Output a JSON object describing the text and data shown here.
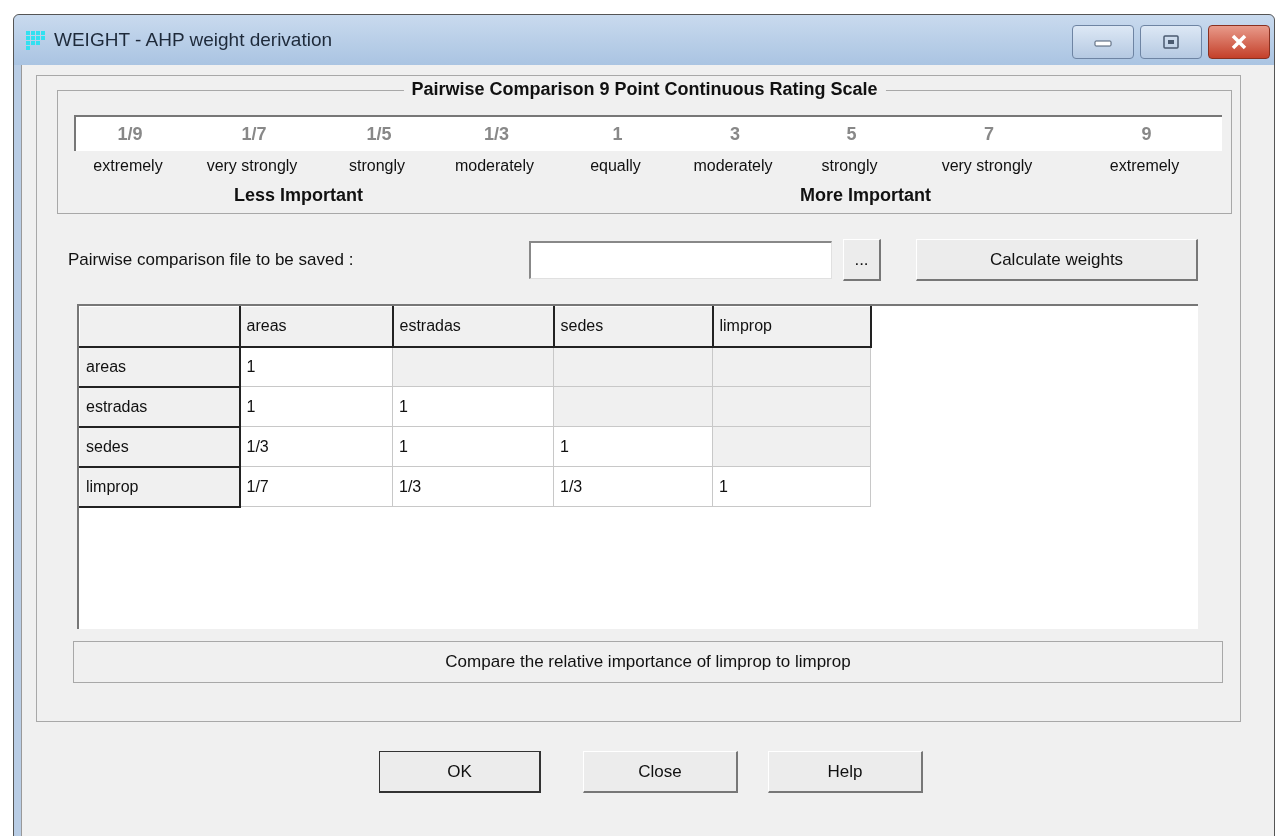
{
  "window": {
    "title": "WEIGHT - AHP weight derivation"
  },
  "scale": {
    "title": "Pairwise Comparison 9 Point Continuous Rating Scale",
    "points": [
      {
        "value": "1/9",
        "label": "extremely"
      },
      {
        "value": "1/7",
        "label": "very strongly"
      },
      {
        "value": "1/5",
        "label": "strongly"
      },
      {
        "value": "1/3",
        "label": "moderately"
      },
      {
        "value": "1",
        "label": "equally"
      },
      {
        "value": "3",
        "label": "moderately"
      },
      {
        "value": "5",
        "label": "strongly"
      },
      {
        "value": "7",
        "label": "very strongly"
      },
      {
        "value": "9",
        "label": "extremely"
      }
    ],
    "sides": [
      "Less Important",
      "More Important"
    ]
  },
  "file_field": {
    "label": "Pairwise comparison file to be saved :",
    "browse_button": "...",
    "calculate_button": "Calculate weights"
  },
  "table": {
    "columns": [
      "areas",
      "estradas",
      "sedes",
      "limprop"
    ],
    "rows": [
      {
        "header": "areas",
        "cells": [
          {
            "text": "1",
            "editable": true
          },
          {
            "editable": false
          },
          {
            "editable": false
          },
          {
            "editable": false
          }
        ]
      },
      {
        "header": "estradas",
        "cells": [
          {
            "text": "1",
            "editable": true
          },
          {
            "text": "1",
            "editable": true
          },
          {
            "editable": false
          },
          {
            "editable": false
          }
        ]
      },
      {
        "header": "sedes",
        "cells": [
          {
            "text": "1/3",
            "editable": true
          },
          {
            "text": "1",
            "editable": true
          },
          {
            "text": "1",
            "editable": true
          },
          {
            "editable": false
          }
        ]
      },
      {
        "header": "limprop",
        "cells": [
          {
            "text": "1/7",
            "editable": true
          },
          {
            "text": "1/3",
            "editable": true
          },
          {
            "text": "1/3",
            "editable": true
          },
          {
            "text": "1",
            "editable": true
          }
        ]
      }
    ]
  },
  "status": "Compare the relative importance of limprop to limprop",
  "buttons": [
    "OK",
    "Close",
    "Help"
  ]
}
